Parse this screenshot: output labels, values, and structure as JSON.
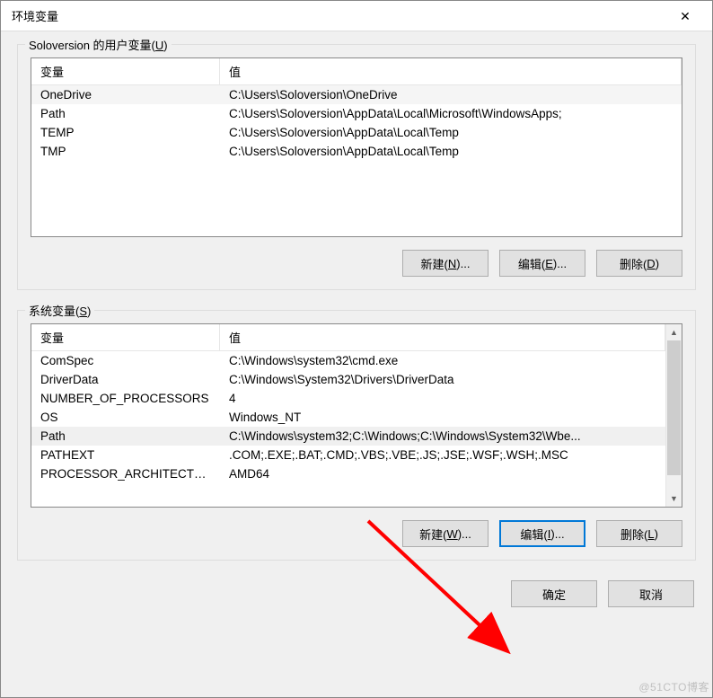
{
  "window": {
    "title": "环境变量",
    "close_icon": "✕"
  },
  "user": {
    "group_label_prefix": "Soloversion 的用户变量(",
    "group_label_key": "U",
    "group_label_suffix": ")",
    "columns": {
      "variable": "变量",
      "value": "值"
    },
    "rows": [
      {
        "var": "OneDrive",
        "val": "C:\\Users\\Soloversion\\OneDrive"
      },
      {
        "var": "Path",
        "val": "C:\\Users\\Soloversion\\AppData\\Local\\Microsoft\\WindowsApps;"
      },
      {
        "var": "TEMP",
        "val": "C:\\Users\\Soloversion\\AppData\\Local\\Temp"
      },
      {
        "var": "TMP",
        "val": "C:\\Users\\Soloversion\\AppData\\Local\\Temp"
      }
    ],
    "buttons": {
      "new": {
        "prefix": "新建(",
        "key": "N",
        "suffix": ")..."
      },
      "edit": {
        "prefix": "编辑(",
        "key": "E",
        "suffix": ")..."
      },
      "delete": {
        "prefix": "删除(",
        "key": "D",
        "suffix": ")"
      }
    }
  },
  "system": {
    "group_label_prefix": "系统变量(",
    "group_label_key": "S",
    "group_label_suffix": ")",
    "columns": {
      "variable": "变量",
      "value": "值"
    },
    "rows": [
      {
        "var": "ComSpec",
        "val": "C:\\Windows\\system32\\cmd.exe"
      },
      {
        "var": "DriverData",
        "val": "C:\\Windows\\System32\\Drivers\\DriverData"
      },
      {
        "var": "NUMBER_OF_PROCESSORS",
        "val": "4"
      },
      {
        "var": "OS",
        "val": "Windows_NT"
      },
      {
        "var": "Path",
        "val": "C:\\Windows\\system32;C:\\Windows;C:\\Windows\\System32\\Wbe..."
      },
      {
        "var": "PATHEXT",
        "val": ".COM;.EXE;.BAT;.CMD;.VBS;.VBE;.JS;.JSE;.WSF;.WSH;.MSC"
      },
      {
        "var": "PROCESSOR_ARCHITECTURE",
        "val": "AMD64"
      }
    ],
    "buttons": {
      "new": {
        "prefix": "新建(",
        "key": "W",
        "suffix": ")..."
      },
      "edit": {
        "prefix": "编辑(",
        "key": "I",
        "suffix": ")..."
      },
      "delete": {
        "prefix": "删除(",
        "key": "L",
        "suffix": ")"
      }
    }
  },
  "bottom": {
    "ok": "确定",
    "cancel": "取消"
  },
  "watermark": "@51CTO博客"
}
